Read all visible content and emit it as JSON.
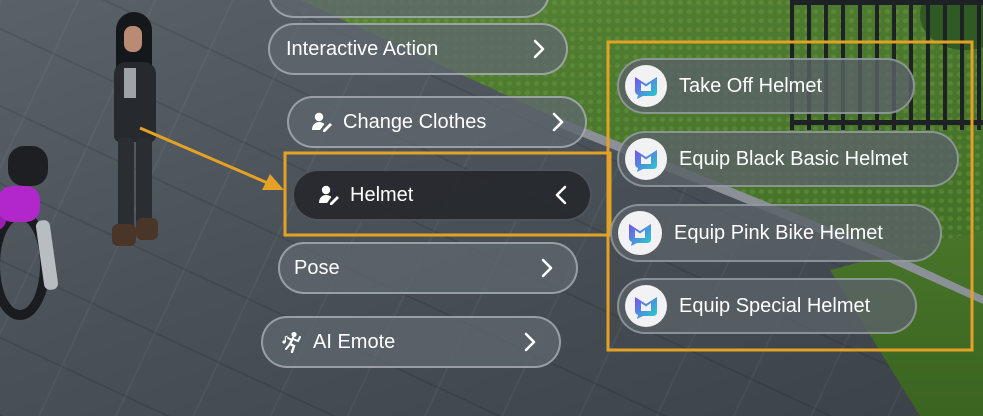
{
  "menu": {
    "items": [
      {
        "label": "Interactive Action",
        "icon": "chevron-right-icon"
      },
      {
        "label": "Change Clothes",
        "icon": "person-edit-icon"
      },
      {
        "label": "Helmet",
        "icon": "person-edit-icon",
        "expanded": true
      },
      {
        "label": "Pose",
        "icon": "chevron-right-icon"
      },
      {
        "label": "AI Emote",
        "icon": "dancing-person-icon"
      }
    ]
  },
  "submenu": {
    "items": [
      {
        "label": "Take Off Helmet",
        "icon": "m-logo-icon"
      },
      {
        "label": "Equip Black Basic Helmet",
        "icon": "m-logo-icon"
      },
      {
        "label": "Equip Pink Bike Helmet",
        "icon": "m-logo-icon"
      },
      {
        "label": "Equip Special Helmet",
        "icon": "m-logo-icon"
      }
    ]
  },
  "colors": {
    "highlight": "#e3a225",
    "pill_bg": "#5f666e",
    "pill_selected_bg": "#26282c",
    "logo_gradient_start": "#7a4ff0",
    "logo_gradient_end": "#1fd6c7"
  }
}
